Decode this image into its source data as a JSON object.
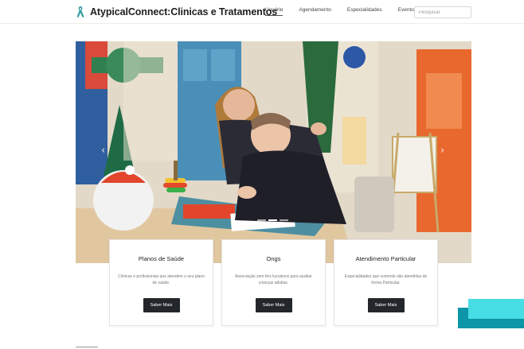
{
  "brand": {
    "name": "AtypicalConnect:Clinicas e Tratamentos",
    "logo_icon": "ribbon-icon",
    "logo_color": "#3aa0a6"
  },
  "nav": {
    "links": [
      {
        "label": "Usuário",
        "active": true
      },
      {
        "label": "Agendamento",
        "active": false
      },
      {
        "label": "Especialidades",
        "active": false
      },
      {
        "label": "Eventos",
        "active": false
      }
    ],
    "search_placeholder": "Pesquisar"
  },
  "hero": {
    "image": "photo-therapist-assisting-young-man-at-table",
    "prev_icon": "chevron-left-icon",
    "next_icon": "chevron-right-icon",
    "prev_glyph": "‹",
    "next_glyph": "›",
    "slides": 3,
    "active_slide": 1
  },
  "cards": [
    {
      "title": "Planos de Saúde",
      "text": "Clínicas e profissionais que atendem o seu plano de saúde.",
      "button": "Saber Mais"
    },
    {
      "title": "Ongs",
      "text": "Associação sem fins lucrativos para auxiliar crianças adultas.",
      "button": "Saber Mais"
    },
    {
      "title": "Atendimento Particular",
      "text": "Especialidades que somente são atendidas de forma Particular.",
      "button": "Saber Mais"
    }
  ],
  "colors": {
    "accent_teal": "#46dde4",
    "accent_teal_dark": "#0d96a7",
    "button_dark": "#23272b"
  }
}
